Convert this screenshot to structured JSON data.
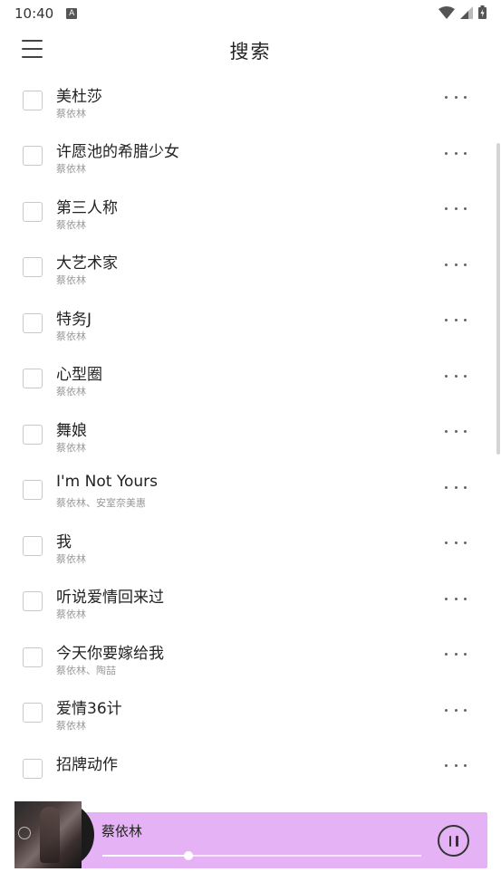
{
  "status": {
    "time": "10:40",
    "notif": "A"
  },
  "header": {
    "title": "搜索"
  },
  "songs": [
    {
      "title": "",
      "artist": "蔡依林"
    },
    {
      "title": "美杜莎",
      "artist": "蔡依林"
    },
    {
      "title": "许愿池的希腊少女",
      "artist": "蔡依林"
    },
    {
      "title": "第三人称",
      "artist": "蔡依林"
    },
    {
      "title": "大艺术家",
      "artist": "蔡依林"
    },
    {
      "title": "特务J",
      "artist": "蔡依林"
    },
    {
      "title": "心型圈",
      "artist": "蔡依林"
    },
    {
      "title": "舞娘",
      "artist": "蔡依林"
    },
    {
      "title": "I'm Not Yours",
      "artist": "蔡依林、安室奈美惠"
    },
    {
      "title": "我",
      "artist": "蔡依林"
    },
    {
      "title": "听说爱情回来过",
      "artist": "蔡依林"
    },
    {
      "title": "今天你要嫁给我",
      "artist": "蔡依林、陶喆"
    },
    {
      "title": "爱情36计",
      "artist": "蔡依林"
    },
    {
      "title": "招牌动作",
      "artist": ""
    }
  ],
  "player": {
    "title": "蔡依林",
    "progress": 0.27
  },
  "colors": {
    "player_bg": "#e5b3f5",
    "accent": "#ffffff"
  }
}
